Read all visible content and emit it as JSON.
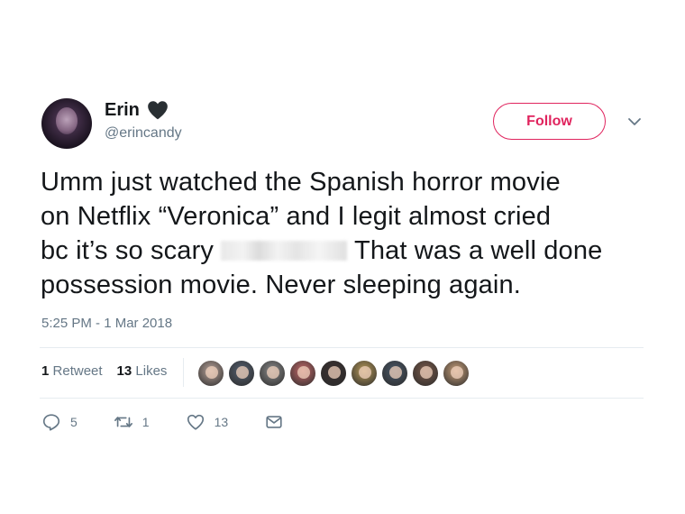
{
  "author": {
    "name": "Erin",
    "handle": "@erincandy",
    "name_emoji": "black-heart-icon"
  },
  "follow_label": "Follow",
  "tweet": {
    "line1": "Umm just watched the Spanish horror movie",
    "line2": "on Netflix “Veronica” and I legit almost cried",
    "line3_before": "bc it’s so scary",
    "line3_after": "That was a well done",
    "line4": "possession movie. Never sleeping again.",
    "timestamp": "5:25 PM - 1 Mar 2018"
  },
  "stats": {
    "retweets_count": "1",
    "retweets_label": "Retweet",
    "likes_count": "13",
    "likes_label": "Likes"
  },
  "liker_avatar_colors": [
    "#b8a39a",
    "#556070",
    "#8a8a8a",
    "#c46a6a",
    "#3a3030",
    "#b89a5a",
    "#4a5868",
    "#7a5a4a",
    "#c9a07a"
  ],
  "actions": {
    "reply_count": "5",
    "retweet_count": "1",
    "like_count": "13"
  },
  "colors": {
    "follow_accent": "#e0245e",
    "secondary_text": "#657786",
    "primary_text": "#14171a"
  }
}
